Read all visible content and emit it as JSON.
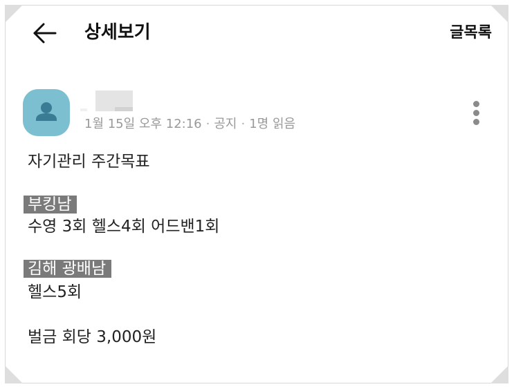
{
  "header": {
    "title": "상세보기",
    "list_label": "글목록",
    "back_icon": "arrow-left-icon"
  },
  "post": {
    "meta": {
      "date": "1월 15일 오후 12:16",
      "separator": "·",
      "category": "공지",
      "read_count": "1명 읽음"
    },
    "body": {
      "subject": "자기관리 주간목표",
      "member1_name": "부킹남",
      "member1_goal": "수영 3회 헬스4회 어드밴1회",
      "member2_name": "김해 광배남",
      "member2_goal": "헬스5회",
      "penalty": "벌금 회당 3,000원"
    }
  },
  "colors": {
    "avatar_bg": "#7bbfd0",
    "highlight_bg": "#7a7a7a",
    "meta_text": "#999999"
  }
}
